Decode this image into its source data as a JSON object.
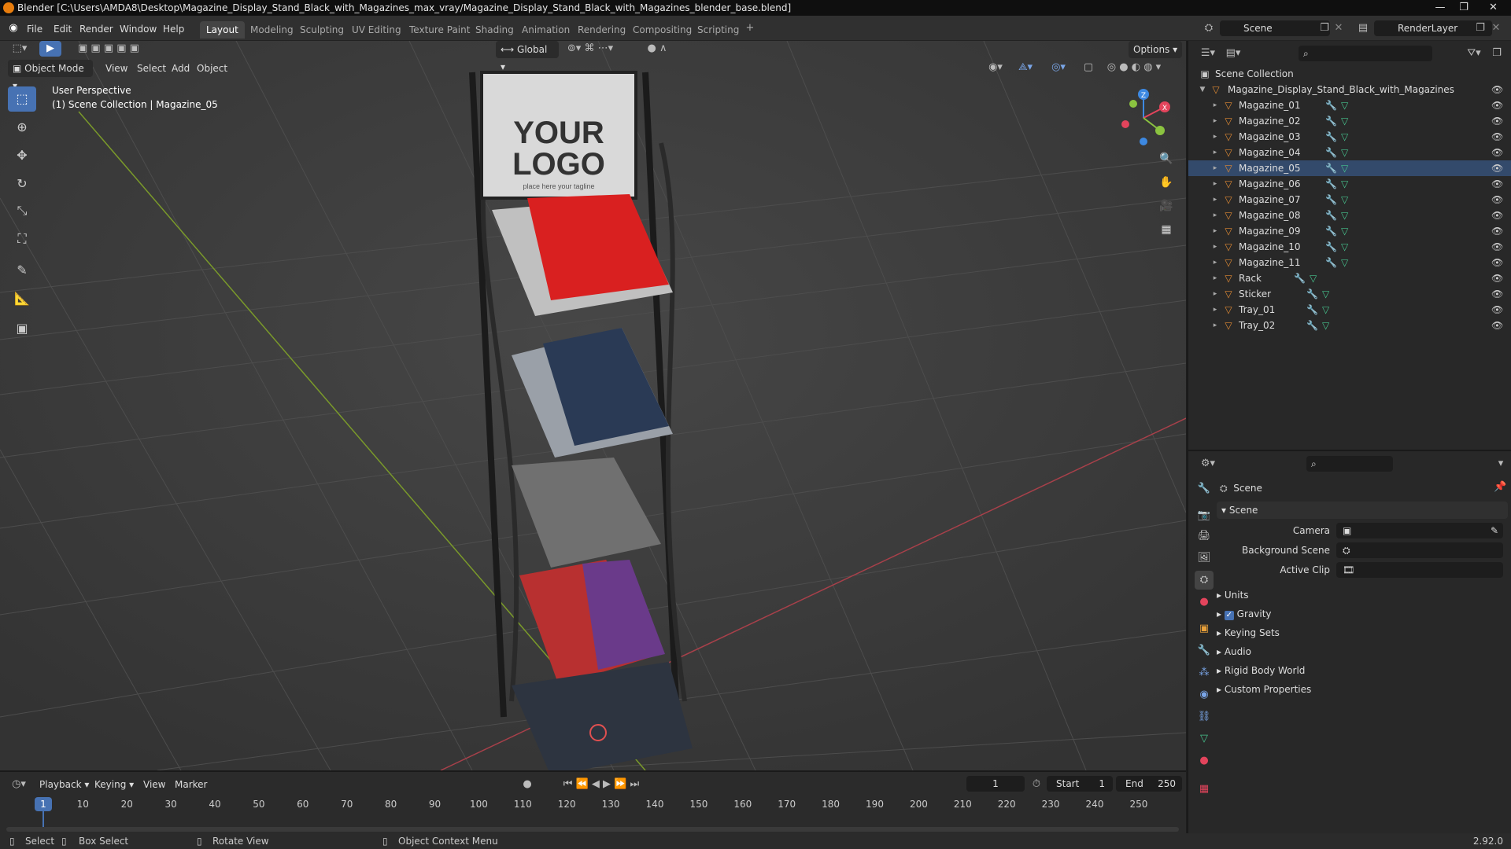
{
  "window": {
    "title": "Blender [C:\\Users\\AMDA8\\Desktop\\Magazine_Display_Stand_Black_with_Magazines_max_vray/Magazine_Display_Stand_Black_with_Magazines_blender_base.blend]"
  },
  "menu": [
    "File",
    "Edit",
    "Render",
    "Window",
    "Help"
  ],
  "workspaces": [
    "Layout",
    "Modeling",
    "Sculpting",
    "UV Editing",
    "Texture Paint",
    "Shading",
    "Animation",
    "Rendering",
    "Compositing",
    "Scripting"
  ],
  "scene_field": "Scene",
  "layer_field": "RenderLayer",
  "header": {
    "orientation": "Global",
    "options": "Options",
    "mode": "Object Mode",
    "menus": [
      "View",
      "Select",
      "Add",
      "Object"
    ]
  },
  "viewport": {
    "perspective": "User Perspective",
    "context": "(1) Scene Collection | Magazine_05",
    "logo_line1": "YOUR",
    "logo_line2": "LOGO",
    "logo_tagline": "place here your tagline"
  },
  "outliner": {
    "root": "Scene Collection",
    "collection": "Magazine_Display_Stand_Black_with_Magazines",
    "objects": [
      "Magazine_01",
      "Magazine_02",
      "Magazine_03",
      "Magazine_04",
      "Magazine_05",
      "Magazine_06",
      "Magazine_07",
      "Magazine_08",
      "Magazine_09",
      "Magazine_10",
      "Magazine_11",
      "Rack",
      "Sticker",
      "Tray_01",
      "Tray_02"
    ],
    "selected": "Magazine_05"
  },
  "properties": {
    "context": "Scene",
    "panel": "Scene",
    "camera_label": "Camera",
    "bg_label": "Background Scene",
    "clip_label": "Active Clip",
    "sections": [
      "Units",
      "Gravity",
      "Keying Sets",
      "Audio",
      "Rigid Body World",
      "Custom Properties"
    ],
    "gravity_checked": true
  },
  "timeline": {
    "menus": [
      "Playback",
      "Keying",
      "View",
      "Marker"
    ],
    "current_frame": "1",
    "start_label": "Start",
    "start": "1",
    "end_label": "End",
    "end": "250",
    "current": 1,
    "ticks": [
      "10",
      "20",
      "30",
      "40",
      "50",
      "60",
      "70",
      "80",
      "90",
      "100",
      "110",
      "120",
      "130",
      "140",
      "150",
      "160",
      "170",
      "180",
      "190",
      "200",
      "210",
      "220",
      "230",
      "240",
      "250"
    ]
  },
  "status": {
    "select": "Select",
    "box_select": "Box Select",
    "rotate": "Rotate View",
    "context_menu": "Object Context Menu",
    "version": "2.92.0"
  },
  "colors": {
    "accent": "#4772b3",
    "orange": "#e87d0d",
    "x_axis": "#e3445c",
    "y_axis": "#8bc340",
    "z_axis": "#3d89e2"
  }
}
